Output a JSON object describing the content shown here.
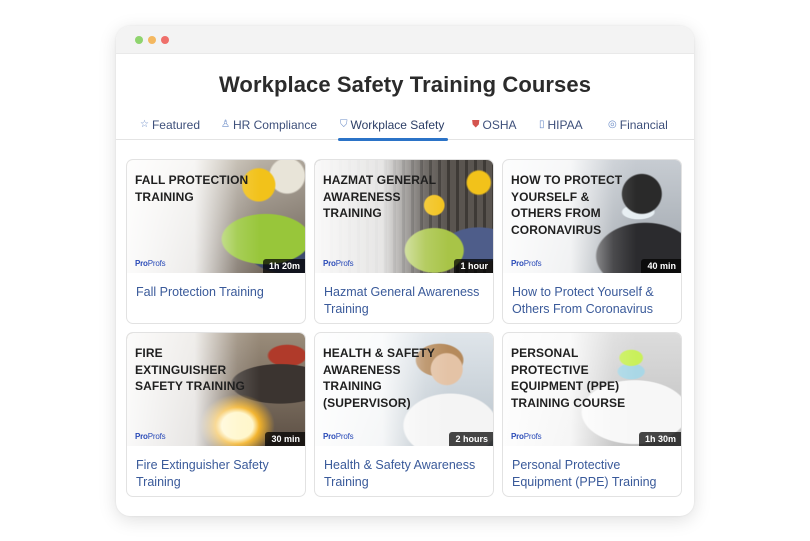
{
  "page": {
    "title": "Workplace Safety Training Courses"
  },
  "tabs": [
    {
      "label": "Featured",
      "icon": "star-icon",
      "active": false
    },
    {
      "label": "HR Compliance",
      "icon": "person-icon",
      "active": false
    },
    {
      "label": "Workplace Safety",
      "icon": "shield-icon",
      "active": true
    },
    {
      "label": "OSHA",
      "icon": "badge-icon",
      "active": false
    },
    {
      "label": "HIPAA",
      "icon": "document-icon",
      "active": false
    },
    {
      "label": "Financial",
      "icon": "coin-icon",
      "active": false
    }
  ],
  "brand": {
    "name_a": "Pro",
    "name_b": "Profs"
  },
  "courses": [
    {
      "overlay": "FALL PROTECTION TRAINING",
      "duration": "1h 20m",
      "name": "Fall Protection Training"
    },
    {
      "overlay": "HAZMAT GENERAL AWARENESS TRAINING",
      "duration": "1 hour",
      "name": "Hazmat General Awareness Training"
    },
    {
      "overlay": "HOW TO PROTECT YOURSELF & OTHERS FROM CORONAVIRUS",
      "duration": "40 min",
      "name": "How to Protect Yourself & Others From Coronavirus"
    },
    {
      "overlay": "FIRE EXTINGUISHER SAFETY TRAINING",
      "duration": "30 min",
      "name": "Fire Extinguisher Safety Training"
    },
    {
      "overlay": "HEALTH & SAFETY AWARENESS TRAINING (SUPERVISOR)",
      "duration": "2 hours",
      "name": "Health & Safety Awareness Training"
    },
    {
      "overlay": "PERSONAL PROTECTIVE EQUIPMENT (PPE) TRAINING COURSE",
      "duration": "1h 30m",
      "name": "Personal Protective Equipment (PPE) Training"
    }
  ],
  "colors": {
    "accent": "#2b73c7",
    "link": "#3a5a9a",
    "brand": "#2a4bb8"
  }
}
